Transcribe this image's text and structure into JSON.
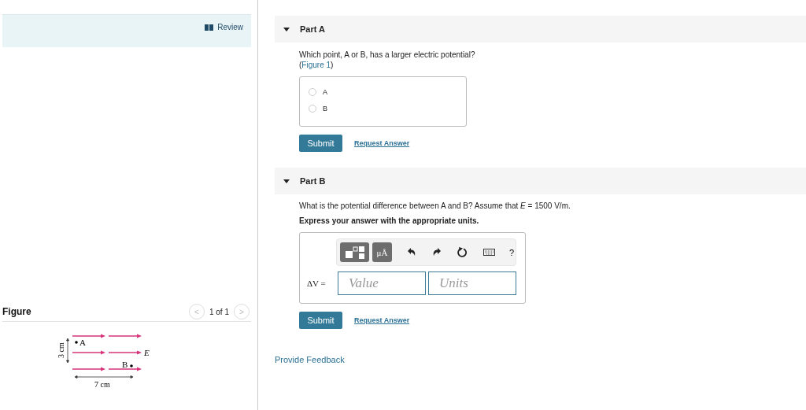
{
  "review": {
    "label": "Review"
  },
  "figure": {
    "title": "Figure",
    "pager": "1 of 1",
    "prev": "<",
    "next": ">",
    "labels": {
      "point_a": "A",
      "point_b": "B",
      "field": "E",
      "height": "3 cm",
      "width": "7 cm"
    }
  },
  "parts": [
    {
      "title": "Part A",
      "expanded": true,
      "kind": "choice",
      "question": "Which point, A or B, has a larger electric potential?",
      "figure_ref": {
        "open": "(",
        "link": "Figure 1",
        "close": ")"
      },
      "choices": [
        {
          "label": "A",
          "selected": false
        },
        {
          "label": "B",
          "selected": false
        }
      ],
      "submit": "Submit",
      "request": "Request Answer"
    },
    {
      "title": "Part B",
      "expanded": true,
      "kind": "numeric",
      "question": "What is the potential difference between A and B? Assume that *E* = 1500 V/m.",
      "instruction": "Express your answer with the appropriate units.",
      "toolbar": {
        "units_button": "μÅ",
        "help": "?"
      },
      "variable": "ΔV =",
      "value_placeholder": "Value",
      "units_placeholder": "Units",
      "submit": "Submit",
      "request": "Request Answer"
    }
  ],
  "feedback_link": "Provide Feedback"
}
